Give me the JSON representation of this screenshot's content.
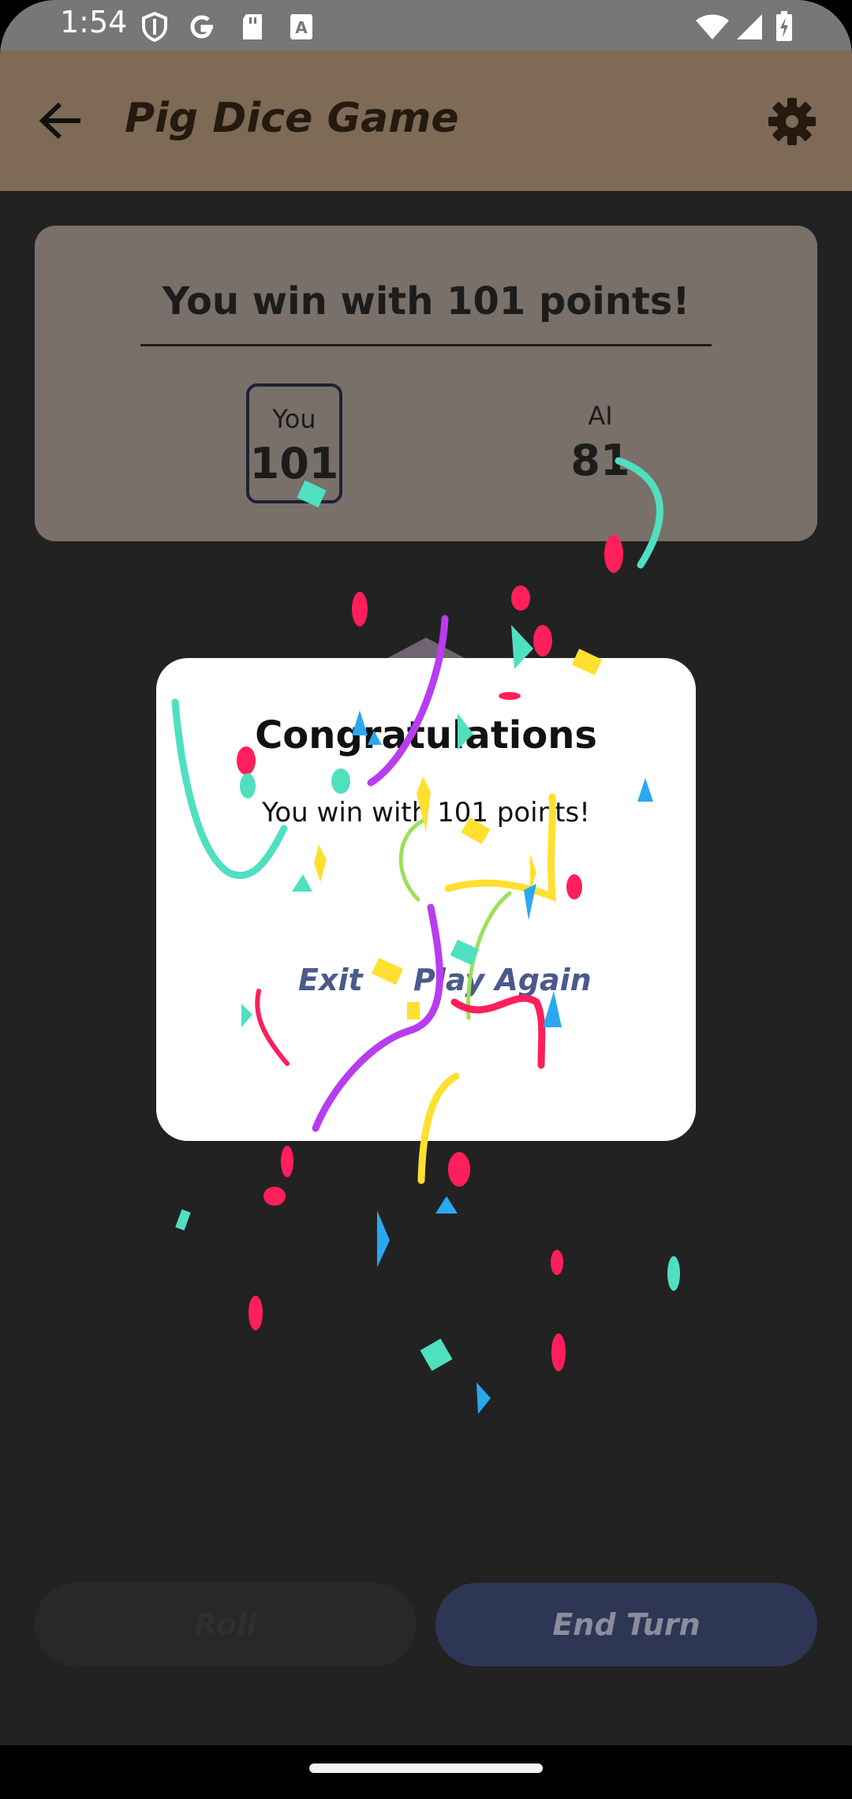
{
  "status_bar": {
    "time": "1:54",
    "icons": [
      "shield-icon",
      "google-icon",
      "sd-card-icon",
      "font-icon",
      "wifi-icon",
      "signal-icon",
      "battery-charging-icon"
    ]
  },
  "app_bar": {
    "title": "Pig Dice Game",
    "back_icon": "arrow-back-icon",
    "settings_icon": "gear-icon"
  },
  "scoreboard": {
    "headline": "You win with 101 points!",
    "players": [
      {
        "label": "You",
        "score": "101",
        "active": true
      },
      {
        "label": "AI",
        "score": "81",
        "active": false
      }
    ]
  },
  "dialog": {
    "title": "Congratulations",
    "message": "You win with 101 points!",
    "exit_label": "Exit",
    "play_again_label": "Play Again"
  },
  "controls": {
    "roll_label": "Roll",
    "end_turn_label": "End Turn"
  },
  "colors": {
    "app_bar": "#7e6a55",
    "background": "#222222",
    "dialog_button": "#4a5a8c",
    "confetti": [
      "#ff1f5a",
      "#4fe0c0",
      "#ffe030",
      "#b83cf0",
      "#2aa8f0",
      "#9be05a"
    ]
  }
}
